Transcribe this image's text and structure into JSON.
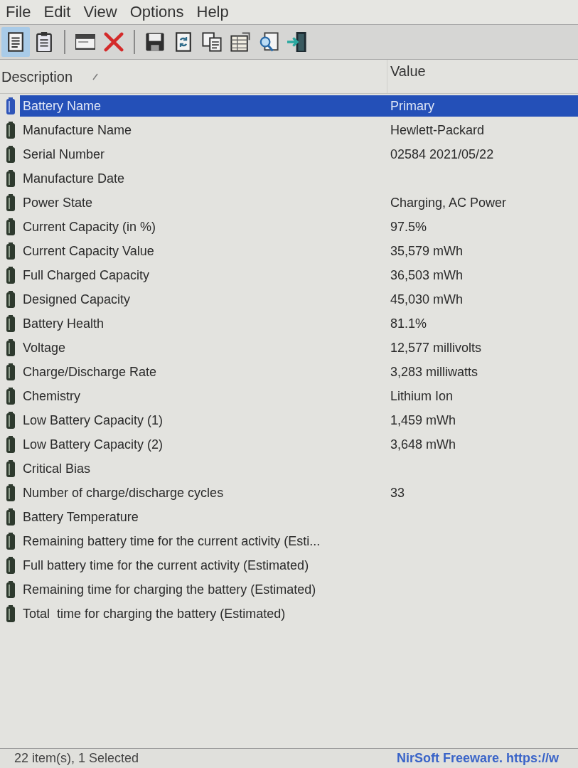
{
  "menu": [
    "File",
    "Edit",
    "View",
    "Options",
    "Help"
  ],
  "toolbar": [
    [
      {
        "kind": "document",
        "highlighted": true
      },
      {
        "kind": "clipboard",
        "highlighted": false
      }
    ],
    [
      {
        "kind": "window",
        "highlighted": false
      },
      {
        "kind": "delete",
        "highlighted": false
      }
    ],
    [
      {
        "kind": "save",
        "highlighted": false
      },
      {
        "kind": "refresh",
        "highlighted": false
      },
      {
        "kind": "copy",
        "highlighted": false
      },
      {
        "kind": "properties",
        "highlighted": false
      },
      {
        "kind": "search",
        "highlighted": false
      },
      {
        "kind": "exit",
        "highlighted": false
      }
    ]
  ],
  "columns": [
    {
      "label": "Description",
      "sorted": true
    },
    {
      "label": "Value",
      "sorted": false
    }
  ],
  "rows": [
    {
      "description": "Battery Name",
      "value": "Primary",
      "selected": true
    },
    {
      "description": "Manufacture Name",
      "value": "Hewlett-Packard",
      "selected": false
    },
    {
      "description": "Serial Number",
      "value": "02584 2021/05/22",
      "selected": false
    },
    {
      "description": "Manufacture Date",
      "selected": false
    },
    {
      "description": "Power State",
      "value": "Charging, AC Power",
      "selected": false
    },
    {
      "description": "Current Capacity (in %)",
      "value": "97.5%",
      "selected": false
    },
    {
      "description": "Current Capacity Value",
      "value": "35,579 mWh",
      "selected": false
    },
    {
      "description": "Full Charged Capacity",
      "value": "36,503 mWh",
      "selected": false
    },
    {
      "description": "Designed Capacity",
      "value": "45,030 mWh",
      "selected": false
    },
    {
      "description": "Battery Health",
      "value": "81.1%",
      "selected": false
    },
    {
      "description": "Voltage",
      "value": "12,577 millivolts",
      "selected": false
    },
    {
      "description": "Charge/Discharge Rate",
      "value": "3,283 milliwatts",
      "selected": false
    },
    {
      "description": "Chemistry",
      "value": "Lithium Ion",
      "selected": false
    },
    {
      "description": "Low Battery Capacity (1)",
      "value": "1,459 mWh",
      "selected": false
    },
    {
      "description": "Low Battery Capacity (2)",
      "value": "3,648 mWh",
      "selected": false
    },
    {
      "description": "Critical Bias",
      "selected": false
    },
    {
      "description": "Number of charge/discharge cycles",
      "value": "33",
      "selected": false
    },
    {
      "description": "Battery Temperature",
      "selected": false
    },
    {
      "description": "Remaining battery time for the current activity (Esti...",
      "selected": false
    },
    {
      "description": "Full battery time for the current activity (Estimated)",
      "selected": false
    },
    {
      "description": "Remaining time for charging the battery (Estimated)",
      "selected": false
    },
    {
      "description": "Total  time for charging the battery (Estimated)",
      "selected": false
    }
  ],
  "status_bar": {
    "summary": "22 item(s), 1 Selected",
    "credit": "NirSoft Freeware. https://w"
  }
}
